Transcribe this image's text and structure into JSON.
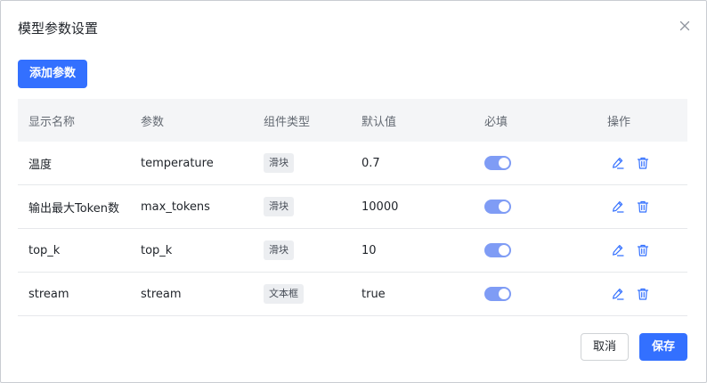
{
  "dialog": {
    "title": "模型参数设置",
    "close_icon": "close-icon"
  },
  "toolbar": {
    "add_label": "添加参数"
  },
  "table": {
    "headers": [
      "显示名称",
      "参数",
      "组件类型",
      "默认值",
      "必填",
      "操作"
    ],
    "rows": [
      {
        "display_name": "温度",
        "param": "temperature",
        "component": "滑块",
        "default": "0.7",
        "required": true
      },
      {
        "display_name": "输出最大Token数",
        "param": "max_tokens",
        "component": "滑块",
        "default": "10000",
        "required": true
      },
      {
        "display_name": "top_k",
        "param": "top_k",
        "component": "滑块",
        "default": "10",
        "required": true
      },
      {
        "display_name": "stream",
        "param": "stream",
        "component": "文本框",
        "default": "true",
        "required": true
      }
    ]
  },
  "footer": {
    "cancel_label": "取消",
    "save_label": "保存"
  },
  "colors": {
    "primary": "#3370ff",
    "switch_on": "#7f9cf5",
    "icon_blue": "#3370ff"
  }
}
